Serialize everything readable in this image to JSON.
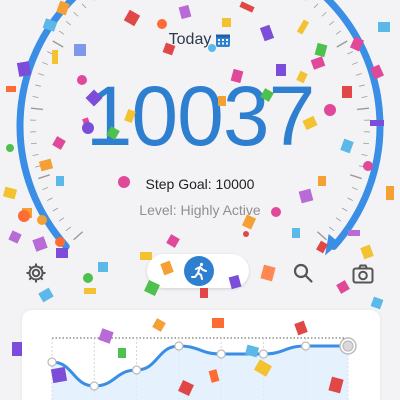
{
  "header": {
    "title": "Today",
    "calendar_icon": "calendar-icon"
  },
  "steps": {
    "count": "10037",
    "goal_label": "Step Goal: 10000",
    "level_label": "Level: Highly Active",
    "progress_fraction": 1.0
  },
  "toolbar": {
    "settings_icon": "gear-icon",
    "activity_icon": "running-person-icon",
    "search_icon": "search-icon",
    "camera_icon": "camera-icon"
  },
  "chart_data": {
    "type": "line",
    "values": [
      6,
      3,
      5,
      8,
      7,
      7,
      8,
      8
    ],
    "ylim": [
      0,
      10
    ],
    "goal_line": 9,
    "grid": true
  },
  "colors": {
    "accent": "#2f7fd0",
    "ring": "#3a8ee6",
    "background": "#f3f3f5"
  }
}
